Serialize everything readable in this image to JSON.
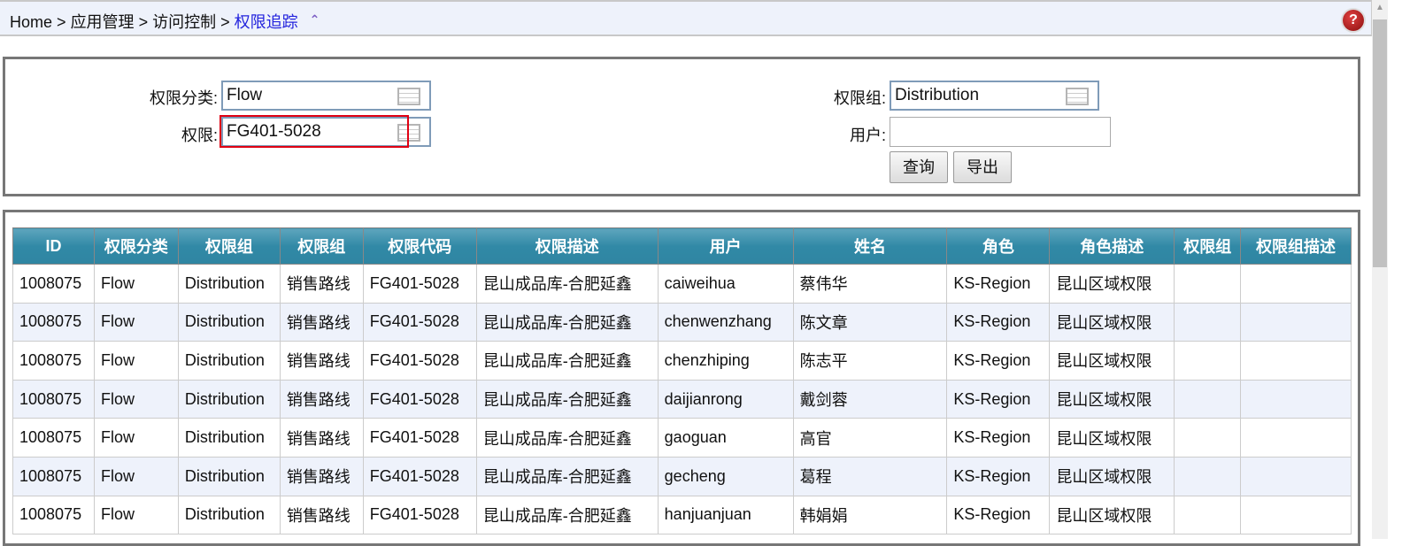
{
  "breadcrumb": {
    "items": [
      "Home",
      "应用管理",
      "访问控制"
    ],
    "current": "权限追踪",
    "separator": ">"
  },
  "search": {
    "category_label": "权限分类:",
    "category_value": "Flow",
    "permission_label": "权限:",
    "permission_value": "FG401-5028",
    "group_label": "权限组:",
    "group_value": "Distribution",
    "user_label": "用户:",
    "user_value": "",
    "query_button": "查询",
    "export_button": "导出"
  },
  "table": {
    "columns": [
      "ID",
      "权限分类",
      "权限组",
      "权限组",
      "权限代码",
      "权限描述",
      "用户",
      "姓名",
      "角色",
      "角色描述",
      "权限组",
      "权限组描述"
    ],
    "rows": [
      [
        "1008075",
        "Flow",
        "Distribution",
        "销售路线",
        "FG401-5028",
        "昆山成品库-合肥延鑫",
        "caiweihua",
        "蔡伟华",
        "KS-Region",
        "昆山区域权限",
        "",
        ""
      ],
      [
        "1008075",
        "Flow",
        "Distribution",
        "销售路线",
        "FG401-5028",
        "昆山成品库-合肥延鑫",
        "chenwenzhang",
        "陈文章",
        "KS-Region",
        "昆山区域权限",
        "",
        ""
      ],
      [
        "1008075",
        "Flow",
        "Distribution",
        "销售路线",
        "FG401-5028",
        "昆山成品库-合肥延鑫",
        "chenzhiping",
        "陈志平",
        "KS-Region",
        "昆山区域权限",
        "",
        ""
      ],
      [
        "1008075",
        "Flow",
        "Distribution",
        "销售路线",
        "FG401-5028",
        "昆山成品库-合肥延鑫",
        "daijianrong",
        "戴剑蓉",
        "KS-Region",
        "昆山区域权限",
        "",
        ""
      ],
      [
        "1008075",
        "Flow",
        "Distribution",
        "销售路线",
        "FG401-5028",
        "昆山成品库-合肥延鑫",
        "gaoguan",
        "高官",
        "KS-Region",
        "昆山区域权限",
        "",
        ""
      ],
      [
        "1008075",
        "Flow",
        "Distribution",
        "销售路线",
        "FG401-5028",
        "昆山成品库-合肥延鑫",
        "gecheng",
        "葛程",
        "KS-Region",
        "昆山区域权限",
        "",
        ""
      ],
      [
        "1008075",
        "Flow",
        "Distribution",
        "销售路线",
        "FG401-5028",
        "昆山成品库-合肥延鑫",
        "hanjuanjuan",
        "韩娟娟",
        "KS-Region",
        "昆山区域权限",
        "",
        ""
      ]
    ]
  },
  "colors": {
    "header": "#3189a6",
    "highlight": "#e00012",
    "link": "#2222dd"
  }
}
